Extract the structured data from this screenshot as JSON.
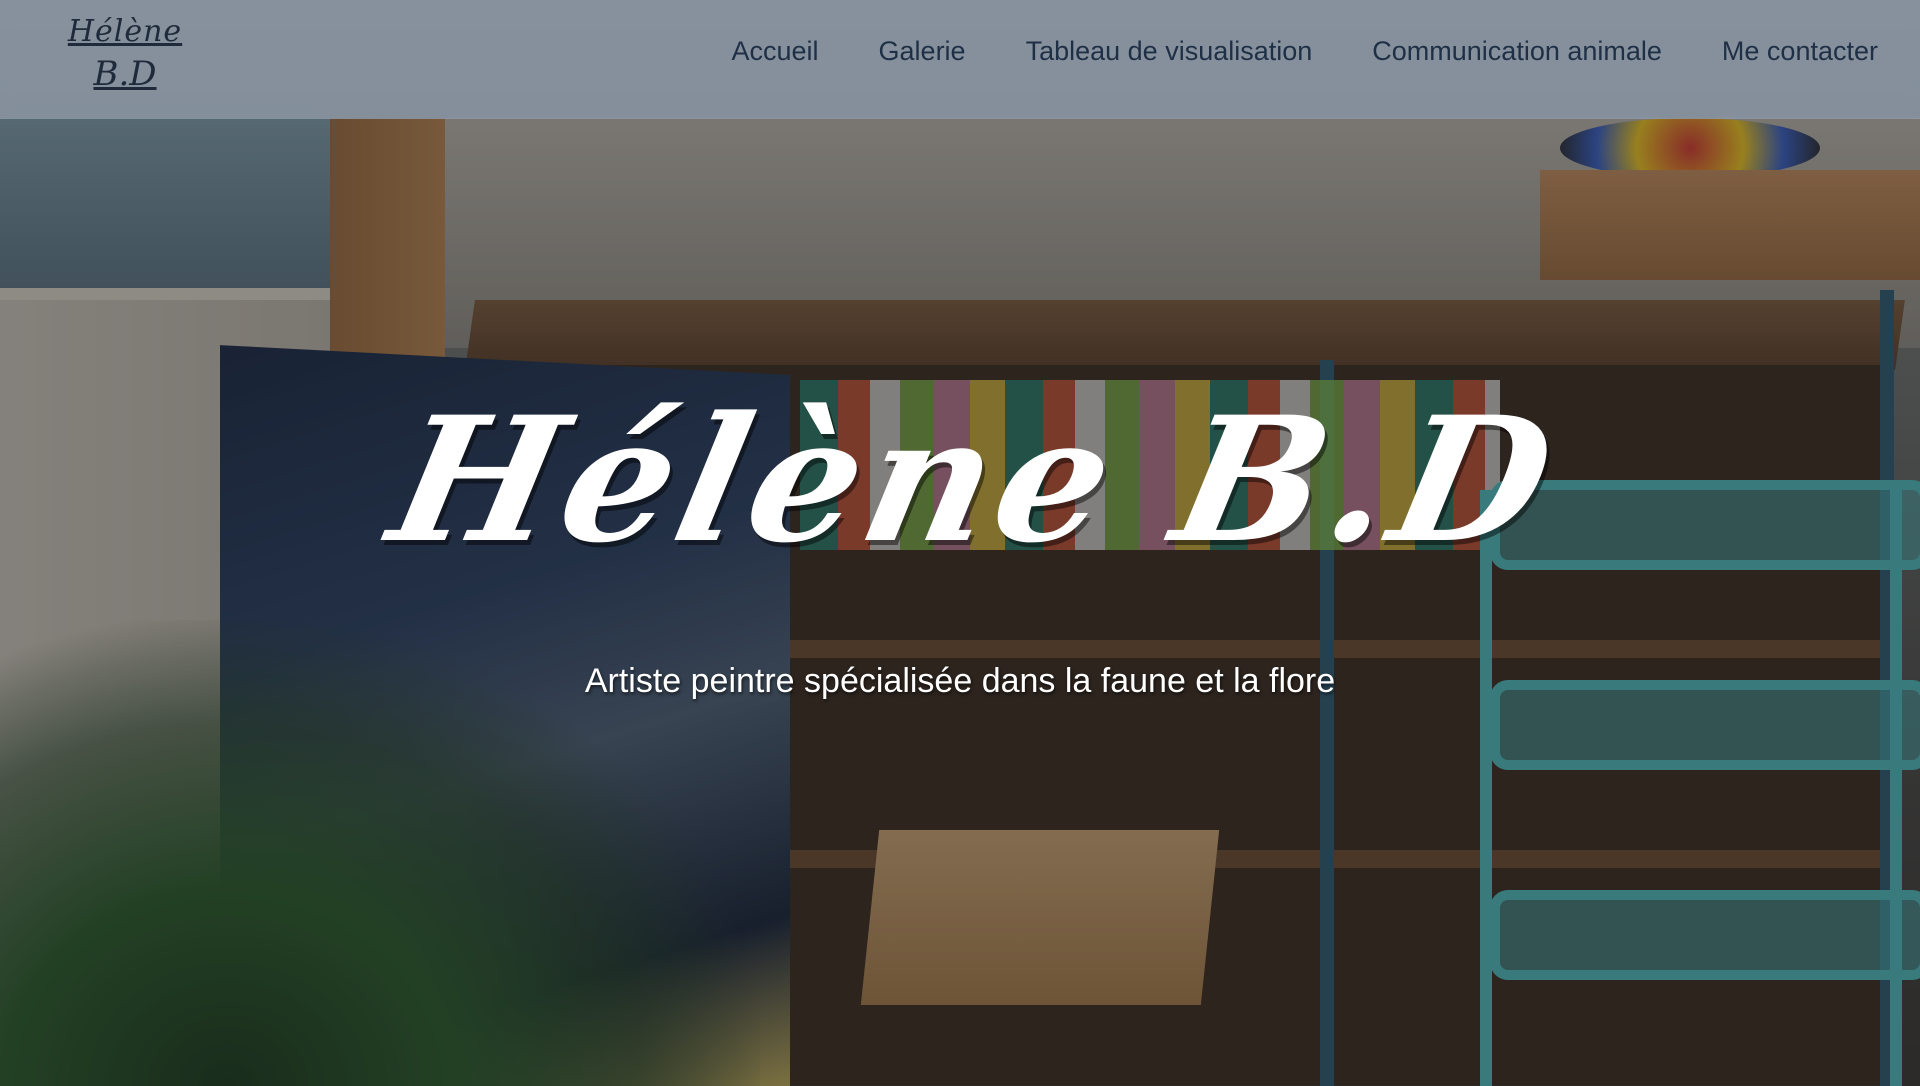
{
  "header": {
    "logo": {
      "line1": "Hélène",
      "line2": "B.D"
    },
    "nav": [
      {
        "label": "Accueil"
      },
      {
        "label": "Galerie"
      },
      {
        "label": "Tableau de visualisation"
      },
      {
        "label": "Communication animale"
      },
      {
        "label": "Me contacter"
      }
    ]
  },
  "hero": {
    "title": "Hélène B.D",
    "subtitle": "Artiste peintre spécialisée dans la faune et la flore",
    "background": "art-studio-photo"
  },
  "colors": {
    "header_bg": "#a0b0c4",
    "nav_text": "#1f2f45",
    "hero_text": "#ffffff"
  }
}
